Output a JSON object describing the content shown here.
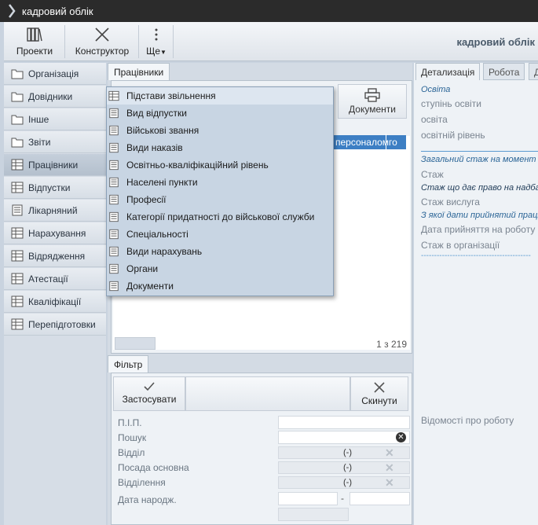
{
  "window": {
    "title": "кадровий облік"
  },
  "toolbar": {
    "projects_label": "Проекти",
    "constructor_label": "Конструктор",
    "more_label": "Ще",
    "app_title": "кадровий облік"
  },
  "sidebar": {
    "items": [
      {
        "label": "Організація",
        "icon": "folder-icon"
      },
      {
        "label": "Довідники",
        "icon": "folder-icon"
      },
      {
        "label": "Інше",
        "icon": "folder-icon"
      },
      {
        "label": "Звіти",
        "icon": "folder-icon"
      },
      {
        "label": "Працівники",
        "icon": "table-icon"
      },
      {
        "label": "Відпустки",
        "icon": "table-icon"
      },
      {
        "label": "Лікарняний",
        "icon": "list-icon"
      },
      {
        "label": "Нарахування",
        "icon": "table-icon"
      },
      {
        "label": "Відрядження",
        "icon": "table-icon"
      },
      {
        "label": "Атестації",
        "icon": "table-icon"
      },
      {
        "label": "Кваліфікації",
        "icon": "table-icon"
      },
      {
        "label": "Перепідготовки",
        "icon": "table-icon"
      }
    ]
  },
  "main": {
    "tab_label": "Працівники",
    "documents_label": "Документи",
    "header_cells": [
      "персоналом",
      "го"
    ],
    "counter": "1 з 219"
  },
  "filter": {
    "tab_label": "Фільтр",
    "apply_label": "Застосувати",
    "reset_label": "Скинути",
    "fields": {
      "name_label": "П.І.П.",
      "search_label": "Пошук",
      "department_label": "Відділ",
      "position_label": "Посада основна",
      "division_label": "Відділення",
      "birthdate_label": "Дата народж."
    },
    "select_value": "(-)",
    "date_separator": "-"
  },
  "right_panel": {
    "tabs": [
      "Детализація",
      "Робота",
      "Д"
    ],
    "education_header": "Освіта",
    "education_rows": [
      "ступінь освіти",
      "освіта",
      "освітній рівень"
    ],
    "total_experience_header": "Загальний стаж на момент пр",
    "experience_label": "Стаж",
    "allowance_header": "Стаж що дає право на надба",
    "seniority_label": "Стаж вислуга",
    "hire_date_header": "З якої дати прийнятий праців",
    "hire_date_label": "Дата прийняття на роботу",
    "org_experience_label": "Стаж в організації",
    "divider": "------------------------------------------",
    "work_info_label": "Відомості про роботу"
  },
  "menu": {
    "items": [
      {
        "label": "Підстави звільнення",
        "icon": "table-icon"
      },
      {
        "label": "Вид відпустки",
        "icon": "list-icon"
      },
      {
        "label": "Військові звання",
        "icon": "list-icon"
      },
      {
        "label": "Види наказів",
        "icon": "list-icon"
      },
      {
        "label": "Освітньо-кваліфікаційний рівень",
        "icon": "list-icon"
      },
      {
        "label": "Населені пункти",
        "icon": "list-icon"
      },
      {
        "label": "Професії",
        "icon": "list-icon"
      },
      {
        "label": "Категорії придатності до військової служби",
        "icon": "list-icon"
      },
      {
        "label": "Спеціальності",
        "icon": "list-icon"
      },
      {
        "label": "Види нарахувань",
        "icon": "list-icon"
      },
      {
        "label": "Органи",
        "icon": "list-icon"
      },
      {
        "label": "Документи",
        "icon": "list-icon"
      }
    ]
  },
  "colors": {
    "accent": "#3d7fc4",
    "titlebar": "#2b2b2b",
    "menu_bg": "#c8d5e3",
    "section_blue": "#2a6496"
  }
}
